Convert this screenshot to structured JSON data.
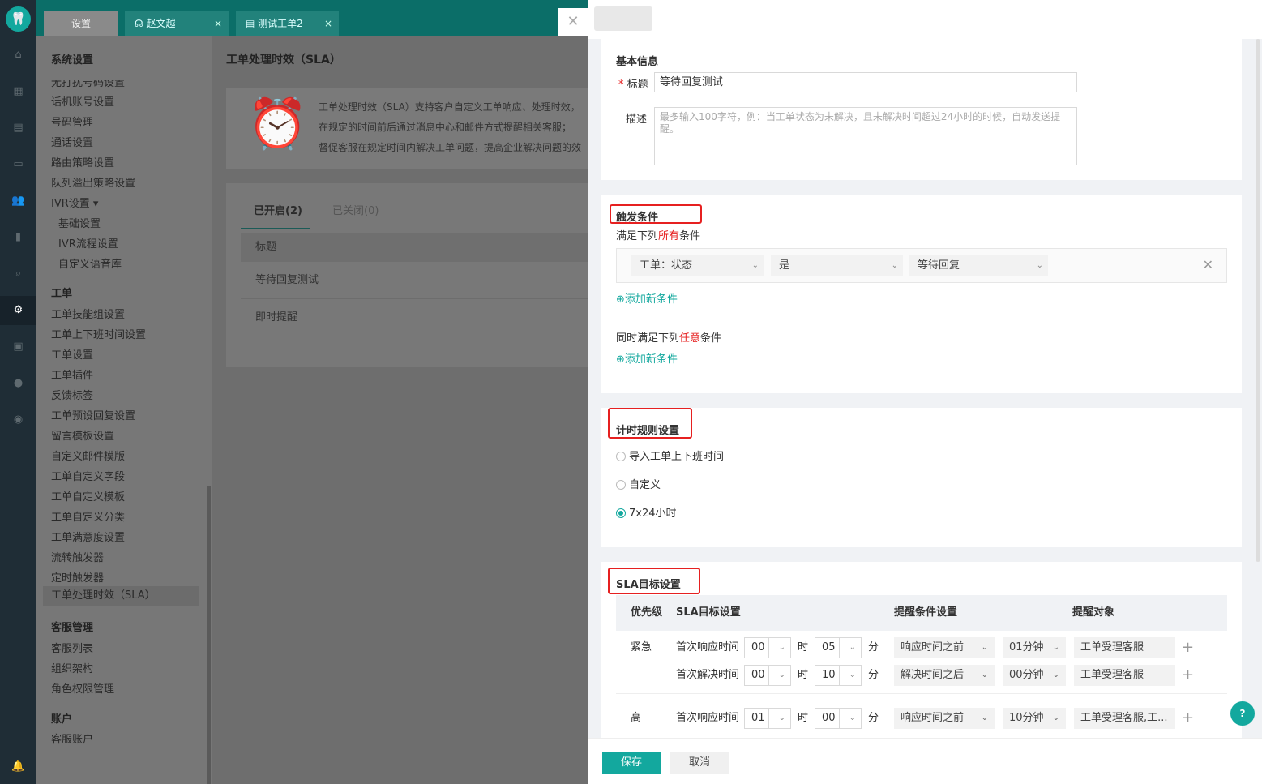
{
  "tabs": [
    {
      "label": "设置"
    },
    {
      "label": "赵文越"
    },
    {
      "label": "测试工单2"
    }
  ],
  "sidebar": {
    "section_system": "系统设置",
    "items_system": [
      "无打扰号码设置",
      "话机账号设置",
      "号码管理",
      "通话设置",
      "路由策略设置",
      "队列溢出策略设置",
      "IVR设置 ▾",
      "基础设置",
      "IVR流程设置",
      "自定义语音库"
    ],
    "section_ticket": "工单",
    "items_ticket": [
      "工单技能组设置",
      "工单上下班时间设置",
      "工单设置",
      "工单插件",
      "反馈标签",
      "工单预设回复设置",
      "留言模板设置",
      "自定义邮件模版",
      "工单自定义字段",
      "工单自定义模板",
      "工单自定义分类",
      "工单满意度设置",
      "流转触发器",
      "定时触发器",
      "工单处理时效（SLA）"
    ],
    "section_agent": "客服管理",
    "items_agent": [
      "客服列表",
      "组织架构",
      "角色权限管理"
    ],
    "section_account": "账户",
    "items_account": [
      "客服账户"
    ]
  },
  "content": {
    "title": "工单处理时效（SLA）",
    "banner_lines": [
      "工单处理时效（SLA）支持客户自定义工单响应、处理时效，",
      "在规定的时间前后通过消息中心和邮件方式提醒相关客服；",
      "督促客服在规定时间内解决工单问题，提高企业解决问题的效"
    ],
    "tab_on": "已开启(2)",
    "tab_off": "已关闭(0)",
    "col_title": "标题",
    "rows": [
      "等待回复测试",
      "即时提醒"
    ]
  },
  "drawer": {
    "basic": {
      "section": "基本信息",
      "title_label": "标题",
      "title_value": "等待回复测试",
      "desc_label": "描述",
      "desc_placeholder": "最多输入100字符，例：当工单状态为未解决，且未解决时间超过24小时的时候，自动发送提醒。"
    },
    "trigger": {
      "section": "触发条件",
      "all_pre": "满足下列",
      "all_hl": "所有",
      "all_post": "条件",
      "cond": {
        "field": "工单：状态",
        "op": "是",
        "value": "等待回复"
      },
      "add": "添加新条件",
      "any_pre": "同时满足下列",
      "any_hl": "任意",
      "any_post": "条件",
      "add2": "添加新条件"
    },
    "timing": {
      "section": "计时规则设置",
      "options": [
        "导入工单上下班时间",
        "自定义",
        "7x24小时"
      ],
      "selected": "7x24小时"
    },
    "sla": {
      "section": "SLA目标设置",
      "headers": {
        "priority": "优先级",
        "target": "SLA目标设置",
        "remind": "提醒条件设置",
        "recipient": "提醒对象"
      },
      "hour_unit": "时",
      "min_unit": "分",
      "rows": [
        {
          "priority": "紧急",
          "label": "首次响应时间",
          "h": "00",
          "m": "05",
          "cond": "响应时间之前",
          "time": "01分钟",
          "who": "工单受理客服"
        },
        {
          "priority": "",
          "label": "首次解决时间",
          "h": "00",
          "m": "10",
          "cond": "解决时间之后",
          "time": "00分钟",
          "who": "工单受理客服"
        },
        {
          "priority": "高",
          "label": "首次响应时间",
          "h": "01",
          "m": "00",
          "cond": "响应时间之前",
          "time": "10分钟",
          "who": "工单受理客服,工..."
        }
      ]
    },
    "save": "保存",
    "cancel": "取消"
  },
  "colors": {
    "accent": "#13a89e",
    "highlight": "#e62020"
  }
}
